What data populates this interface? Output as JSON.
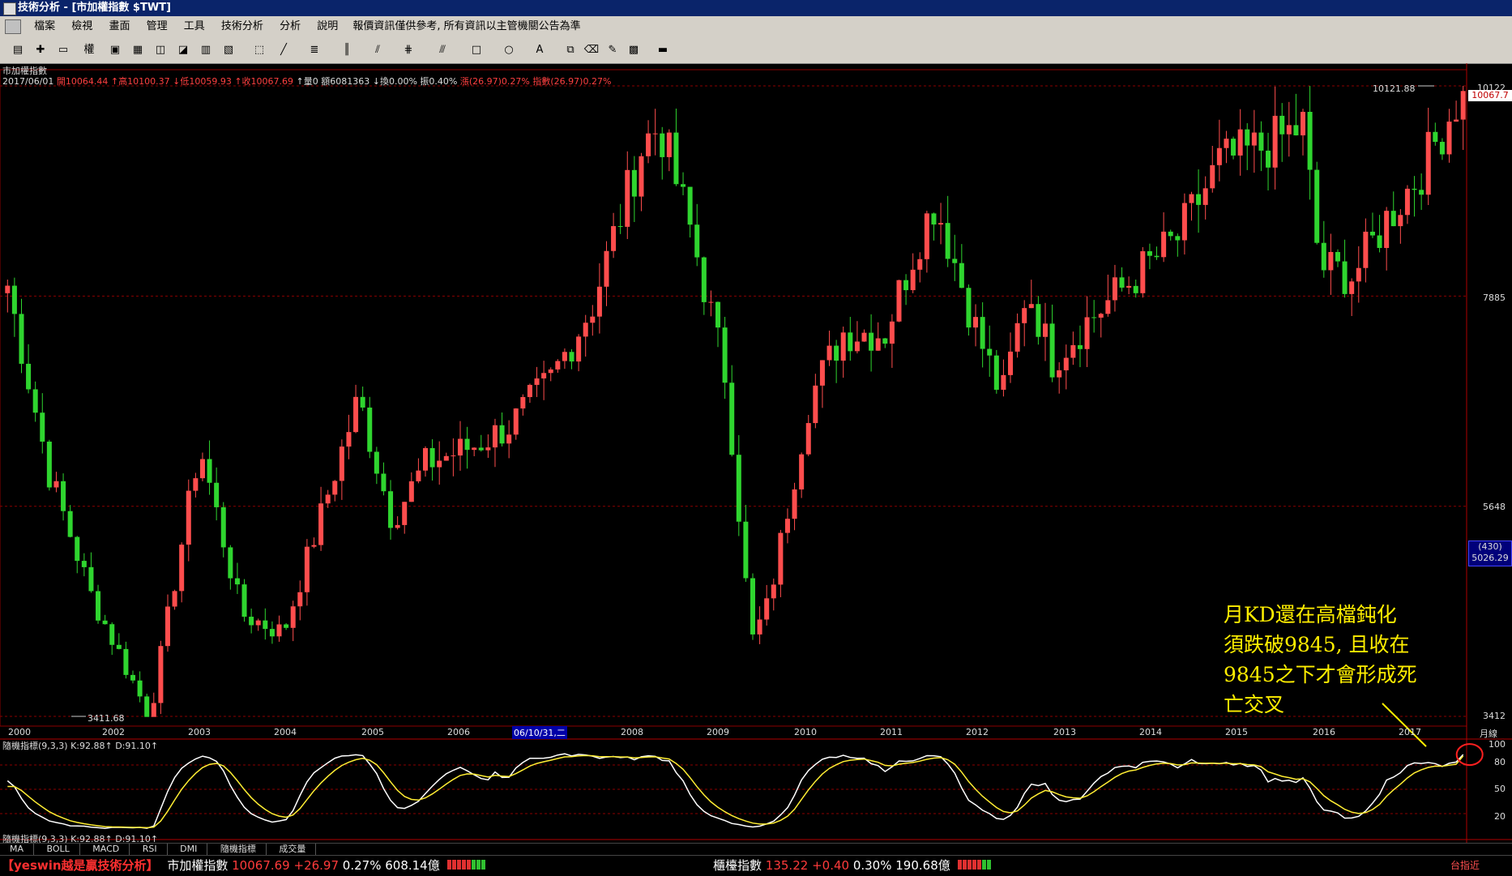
{
  "window": {
    "title": "技術分析 - [市加權指數 $TWT]"
  },
  "menu": {
    "items": [
      "檔案",
      "檢視",
      "畫面",
      "管理",
      "工具",
      "技術分析",
      "分析",
      "說明"
    ],
    "notice": "報價資訊僅供參考, 所有資訊以主管機關公告為準"
  },
  "chart_header": {
    "name": "市加權指數",
    "date": "2017/06/01",
    "fields": [
      {
        "text": "開10064.44",
        "color": "r"
      },
      {
        "text": "↑高10100.37",
        "color": "r"
      },
      {
        "text": "↓低10059.93",
        "color": "r"
      },
      {
        "text": "↑收10067.69",
        "color": "r"
      },
      {
        "text": "↑量0",
        "color": "w"
      },
      {
        "text": "額6081363",
        "color": "w"
      },
      {
        "text": "↓換0.00%",
        "color": "w"
      },
      {
        "text": "振0.40%",
        "color": "w"
      },
      {
        "text": "漲(26.97)0.27%",
        "color": "r"
      },
      {
        "text": "指數(26.97)0.27%",
        "color": "r"
      }
    ]
  },
  "y_axis": {
    "ticks": [
      "10122",
      "7885",
      "5648",
      "3412"
    ],
    "last_price": "10067.7",
    "cursor_box_top": "(430)",
    "cursor_box_bottom": "5026.29"
  },
  "annotations_price": {
    "high": "10121.88",
    "low": "3411.68"
  },
  "x_axis": {
    "labels": [
      "2000",
      "2002",
      "2003",
      "2004",
      "2005",
      "2006",
      "2008",
      "2009",
      "2010",
      "2011",
      "2012",
      "2013",
      "2014",
      "2015",
      "2016",
      "2017"
    ],
    "selected": "06/10/31,二",
    "period": "月線"
  },
  "kd": {
    "label": "隨機指標(9,3,3)",
    "k_text": "K:92.88↑",
    "d_text": "D:91.10↑",
    "axis": [
      "100",
      "80",
      "50",
      "20"
    ]
  },
  "tabs": [
    "MA",
    "BOLL",
    "MACD",
    "RSI",
    "DMI",
    "隨機指標",
    "成交量"
  ],
  "status": {
    "brand": "【yeswin越是贏技術分析】",
    "taiex_name": "市加權指數",
    "taiex_value": "10067.69",
    "taiex_change": "+26.97",
    "taiex_pct": "0.27%",
    "taiex_amount": "608.14億",
    "otc_name": "櫃檯指數",
    "otc_value": "135.22",
    "otc_change": "+0.40",
    "otc_pct": "0.30%",
    "otc_amount": "190.68億",
    "right_label": "台指近"
  },
  "note": {
    "lines": [
      "月KD還在高檔鈍化",
      "須跌破9845, 且收在",
      "9845之下才會形成死",
      "亡交叉"
    ]
  },
  "colors": {
    "up": "#ff4d4d",
    "down": "#2fd52f",
    "k_line": "#ffffff",
    "d_line": "#ffee33",
    "grid": "#8b0000"
  },
  "chart_data": {
    "type": "candlestick",
    "title": "市加權指數",
    "period": "月線",
    "ylim": [
      3411.68,
      10121.88
    ],
    "series": [
      {
        "name": "K",
        "values": [
          92.88
        ]
      },
      {
        "name": "D",
        "values": [
          91.1
        ]
      }
    ],
    "anchors": [
      {
        "year": 2000,
        "close": 8000
      },
      {
        "year": 2000.5,
        "close": 6000
      },
      {
        "year": 2001,
        "close": 4700
      },
      {
        "year": 2001.7,
        "close": 3411.68
      },
      {
        "year": 2002.3,
        "close": 6300
      },
      {
        "year": 2002.8,
        "close": 4500
      },
      {
        "year": 2003.3,
        "close": 4300
      },
      {
        "year": 2004.2,
        "close": 6800
      },
      {
        "year": 2004.6,
        "close": 5500
      },
      {
        "year": 2005.0,
        "close": 6100
      },
      {
        "year": 2005.6,
        "close": 6300
      },
      {
        "year": 2006.0,
        "close": 6500
      },
      {
        "year": 2006.5,
        "close": 7000
      },
      {
        "year": 2007.0,
        "close": 7800
      },
      {
        "year": 2007.6,
        "close": 9500
      },
      {
        "year": 2007.8,
        "close": 9700
      },
      {
        "year": 2008.2,
        "close": 8500
      },
      {
        "year": 2008.6,
        "close": 7000
      },
      {
        "year": 2008.9,
        "close": 4200
      },
      {
        "year": 2009.1,
        "close": 4600
      },
      {
        "year": 2009.6,
        "close": 6800
      },
      {
        "year": 2010.0,
        "close": 7500
      },
      {
        "year": 2010.5,
        "close": 7500
      },
      {
        "year": 2010.9,
        "close": 8500
      },
      {
        "year": 2011.1,
        "close": 8900
      },
      {
        "year": 2011.6,
        "close": 7500
      },
      {
        "year": 2011.9,
        "close": 6800
      },
      {
        "year": 2012.2,
        "close": 8000
      },
      {
        "year": 2012.5,
        "close": 7200
      },
      {
        "year": 2012.9,
        "close": 7600
      },
      {
        "year": 2013.5,
        "close": 8100
      },
      {
        "year": 2014.0,
        "close": 8500
      },
      {
        "year": 2014.5,
        "close": 9300
      },
      {
        "year": 2015.1,
        "close": 9500
      },
      {
        "year": 2015.5,
        "close": 9700
      },
      {
        "year": 2015.7,
        "close": 8200
      },
      {
        "year": 2016.1,
        "close": 8100
      },
      {
        "year": 2016.5,
        "close": 8700
      },
      {
        "year": 2016.9,
        "close": 9200
      },
      {
        "year": 2017.4,
        "close": 10067.69
      }
    ]
  }
}
